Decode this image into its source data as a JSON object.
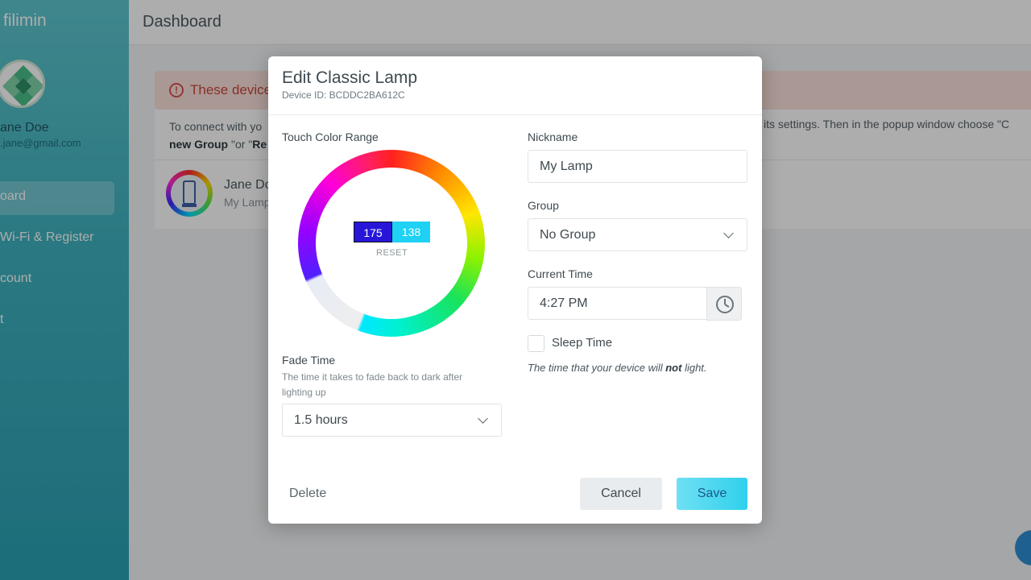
{
  "app": {
    "brand": "filimin",
    "user": {
      "name": "ane Doe",
      "email": ".jane@gmail.com"
    },
    "nav": [
      {
        "label": "oard",
        "active": true
      },
      {
        "label": "Wi-Fi & Register",
        "active": false
      },
      {
        "label": "count",
        "active": false
      },
      {
        "label": "t",
        "active": false
      }
    ],
    "page_title": "Dashboard",
    "alert": {
      "text": "These device"
    },
    "info": {
      "line1": "To connect with yo",
      "line2_bold1": "new Group",
      "line2_mid": " \"or \"",
      "line2_bold2": "Re",
      "right": "its settings. Then in the popup window choose \"C"
    },
    "device": {
      "name": "Jane Do",
      "sub": "My Lamp"
    }
  },
  "modal": {
    "title": "Edit Classic Lamp",
    "device_id": "Device ID: BCDDC2BA612C",
    "touch_color_range_label": "Touch Color Range",
    "range_start": "175",
    "range_end": "138",
    "reset_label": "RESET",
    "fade_time_label": "Fade Time",
    "fade_time_help": "The time it takes to fade back to dark after lighting up",
    "fade_time_value": "1.5 hours",
    "nickname_label": "Nickname",
    "nickname_value": "My Lamp",
    "group_label": "Group",
    "group_value": "No Group",
    "current_time_label": "Current Time",
    "current_time_value": "4:27 PM",
    "sleep_time_label": "Sleep Time",
    "note_before": "The time that your device will ",
    "note_bold": "not",
    "note_after": " light.",
    "delete_label": "Delete",
    "cancel_label": "Cancel",
    "save_label": "Save"
  }
}
